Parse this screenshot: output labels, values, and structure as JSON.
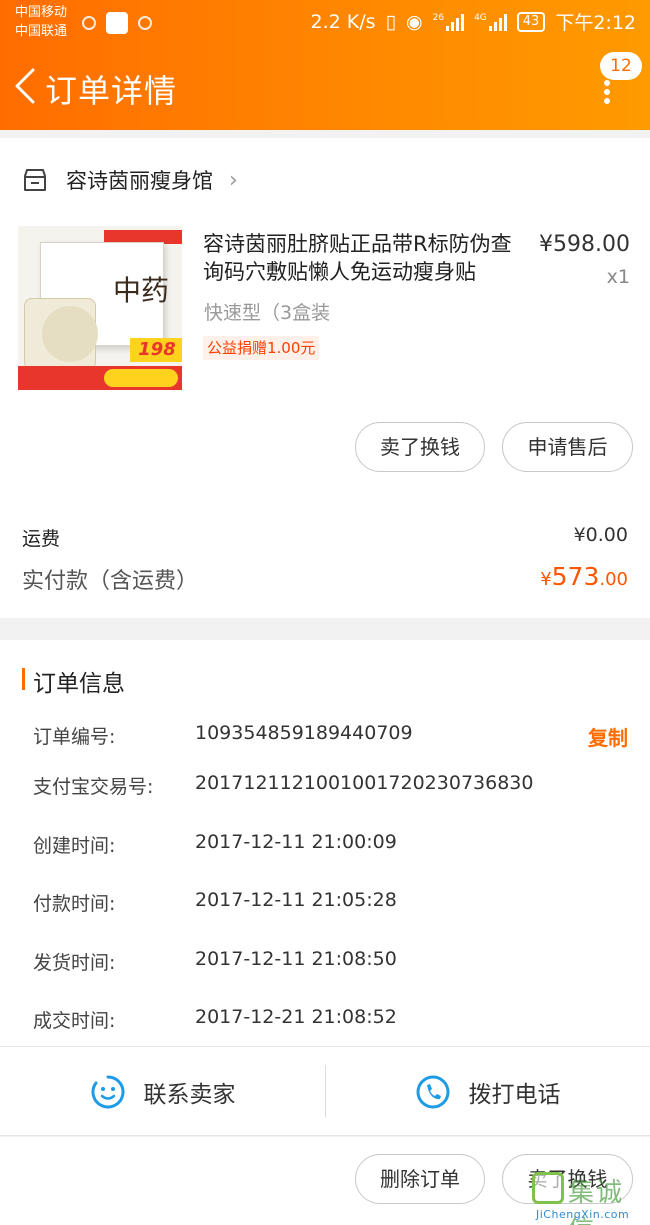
{
  "status_bar": {
    "carrier_1": "中国移动",
    "carrier_2": "中国联通",
    "net_speed": "2.2 K/s",
    "sig1_label": "26",
    "sig2_label": "4G",
    "battery": "43",
    "time": "下午2:12"
  },
  "header": {
    "title": "订单详情",
    "message_count": "12"
  },
  "shop": {
    "name": "容诗茵丽瘦身馆"
  },
  "product": {
    "title": "容诗茵丽肚脐贴正品带R标防伪查询码穴敷贴懒人免运动瘦身贴",
    "price": "¥598.00",
    "quantity": "x1",
    "sku": "快速型（3盒装",
    "charity": "公益捐赠1.00元",
    "thumb_char": "中药",
    "thumb_price": "198"
  },
  "item_actions": {
    "sell_label": "卖了换钱",
    "aftersale_label": "申请售后"
  },
  "totals": {
    "shipping_label": "运费",
    "shipping_value": "¥0.00",
    "paid_label": "实付款（含运费）",
    "paid_currency": "¥",
    "paid_integer": "573",
    "paid_decimal": ".00"
  },
  "order_info": {
    "title": "订单信息",
    "copy_label": "复制",
    "rows": [
      {
        "key": "订单编号:",
        "value": "109354859189440709"
      },
      {
        "key": "支付宝交易号:",
        "value": "2017121121001001720230736830"
      },
      {
        "key": "创建时间:",
        "value": "2017-12-11 21:00:09"
      },
      {
        "key": "付款时间:",
        "value": "2017-12-11 21:05:28"
      },
      {
        "key": "发货时间:",
        "value": "2017-12-11 21:08:50"
      },
      {
        "key": "成交时间:",
        "value": "2017-12-21 21:08:52"
      }
    ]
  },
  "contact": {
    "seller_label": "联系卖家",
    "phone_label": "拨打电话"
  },
  "bottom_actions": {
    "delete_label": "删除订单",
    "sell_label": "卖了换钱"
  },
  "watermark": {
    "text": "集诚信",
    "url": "JiChengXin.com"
  },
  "colors": {
    "accent": "#ff6d00",
    "price_red": "#ff5500"
  }
}
